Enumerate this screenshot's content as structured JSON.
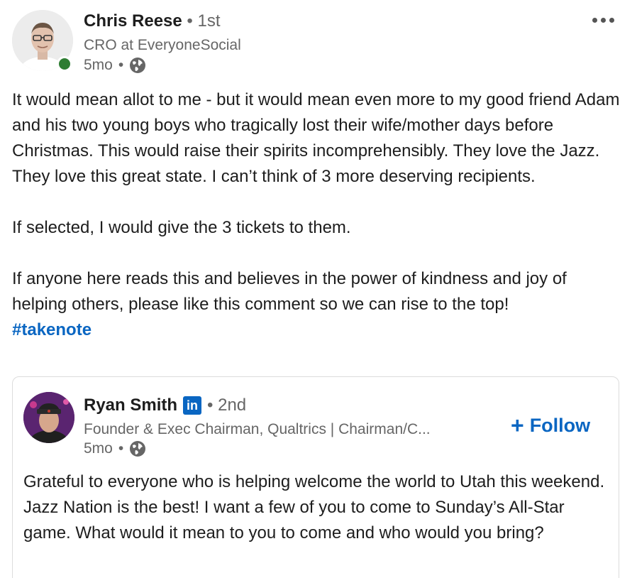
{
  "comment": {
    "author": {
      "name": "Chris Reese",
      "degree": "• 1st",
      "headline": "CRO at EveryoneSocial",
      "time": "5mo",
      "separator": "•"
    },
    "body": {
      "paragraph_1": "It would mean allot to me - but it would mean even more to my good friend Adam and his two young boys who tragically lost their wife/mother days before Christmas. This would raise their spirits incomprehensibly. They love the Jazz. They love this great state. I can’t think of 3 more deserving recipients.",
      "paragraph_2": "If selected, I would give the 3 tickets to them.",
      "paragraph_3": "If anyone here reads this and believes in the power of kindness and joy of helping others, please like this comment so we can rise to the top!",
      "hashtag": "#takenote"
    }
  },
  "shared_post": {
    "author": {
      "name": "Ryan Smith",
      "badge": "in",
      "degree": "• 2nd",
      "headline": "Founder & Exec Chairman, Qualtrics | Chairman/C...",
      "time": "5mo",
      "separator": "•"
    },
    "follow": {
      "plus": "+",
      "label": "Follow"
    },
    "text": "Grateful to everyone who is helping welcome the world to Utah this weekend. Jazz Nation is the best! I want a few of you to come to Sunday’s All-Star game. What would it mean to you to come and who would you bring?"
  },
  "colors": {
    "link_blue": "#0a66c2",
    "online_green": "#2e7d32",
    "muted_text": "#666666"
  },
  "icons": [
    "globe-icon",
    "more-options-icon",
    "linkedin-badge-icon",
    "plus-icon",
    "online-status-icon"
  ]
}
